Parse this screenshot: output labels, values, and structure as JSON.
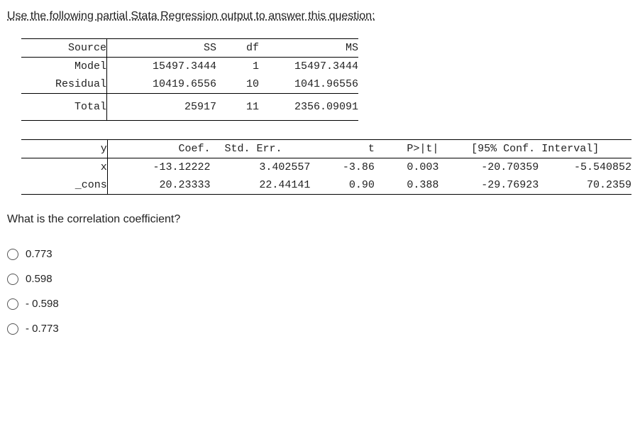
{
  "intro": "Use the following partial Stata Regression output to answer this question:",
  "anova": {
    "headers": {
      "source": "Source",
      "ss": "SS",
      "df": "df",
      "ms": "MS"
    },
    "rows": [
      {
        "source": "Model",
        "ss": "15497.3444",
        "df": "1",
        "ms": "15497.3444"
      },
      {
        "source": "Residual",
        "ss": "10419.6556",
        "df": "10",
        "ms": "1041.96556"
      }
    ],
    "total": {
      "source": "Total",
      "ss": "25917",
      "df": "11",
      "ms": "2356.09091"
    }
  },
  "coef": {
    "headers": {
      "y": "y",
      "coef": "Coef.",
      "se": "Std. Err.",
      "t": "t",
      "p": "P>|t|",
      "ci": "[95% Conf. Interval]"
    },
    "rows": [
      {
        "y": "x",
        "coef": "-13.12222",
        "se": "3.402557",
        "t": "-3.86",
        "p": "0.003",
        "lo": "-20.70359",
        "hi": "-5.540852"
      },
      {
        "y": "_cons",
        "coef": "20.23333",
        "se": "22.44141",
        "t": "0.90",
        "p": "0.388",
        "lo": "-29.76923",
        "hi": "70.2359"
      }
    ]
  },
  "question": "What is the correlation coefficient?",
  "options": [
    "0.773",
    "0.598",
    "- 0.598",
    "- 0.773"
  ]
}
